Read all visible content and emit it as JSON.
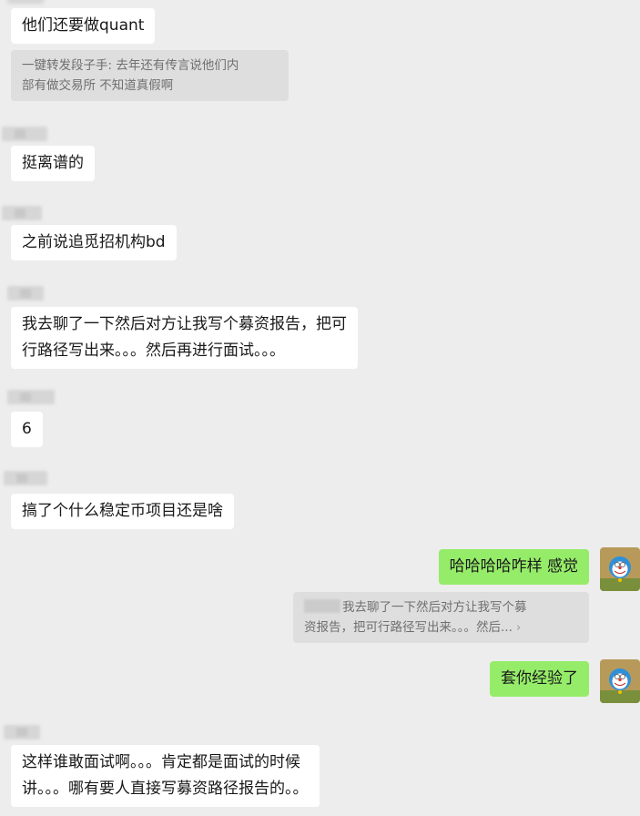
{
  "messages": [
    {
      "side": "left",
      "text": "他们还要做quant"
    },
    {
      "side": "left",
      "quote": [
        "一键转发段子手: 去年还有传言说他们内",
        "部有做交易所 不知道真假啊"
      ]
    },
    {
      "side": "left",
      "text": "挺离谱的"
    },
    {
      "side": "left",
      "text": "之前说追觅招机构bd"
    },
    {
      "side": "left",
      "lines": [
        "我去聊了一下然后对方让我写个募资报告，把可",
        "行路径写出来。。。然后再进行面试。。。"
      ]
    },
    {
      "side": "left",
      "text": "6"
    },
    {
      "side": "left",
      "text": "搞了个什么稳定币项目还是啥"
    },
    {
      "side": "right",
      "text": "哈哈哈哈咋样 感觉"
    },
    {
      "side": "right",
      "quote": [
        "我去聊了一下然后对方让我写个募",
        "资报告，把可行路径写出来。。。然后..."
      ]
    },
    {
      "side": "right",
      "text": "套你经验了"
    },
    {
      "side": "left",
      "lines": [
        "这样谁敢面试啊。。。肯定都是面试的时候",
        "讲。。。哪有要人直接写募资路径报告的。。"
      ]
    }
  ],
  "colors": {
    "background": "#ededed",
    "incoming_bubble": "#ffffff",
    "outgoing_bubble": "#95ec69",
    "quote_block": "#dedede"
  },
  "icons": {
    "avatar": "cartoon-robot-cat-avatar",
    "quote_more": "chevron-right-icon"
  }
}
